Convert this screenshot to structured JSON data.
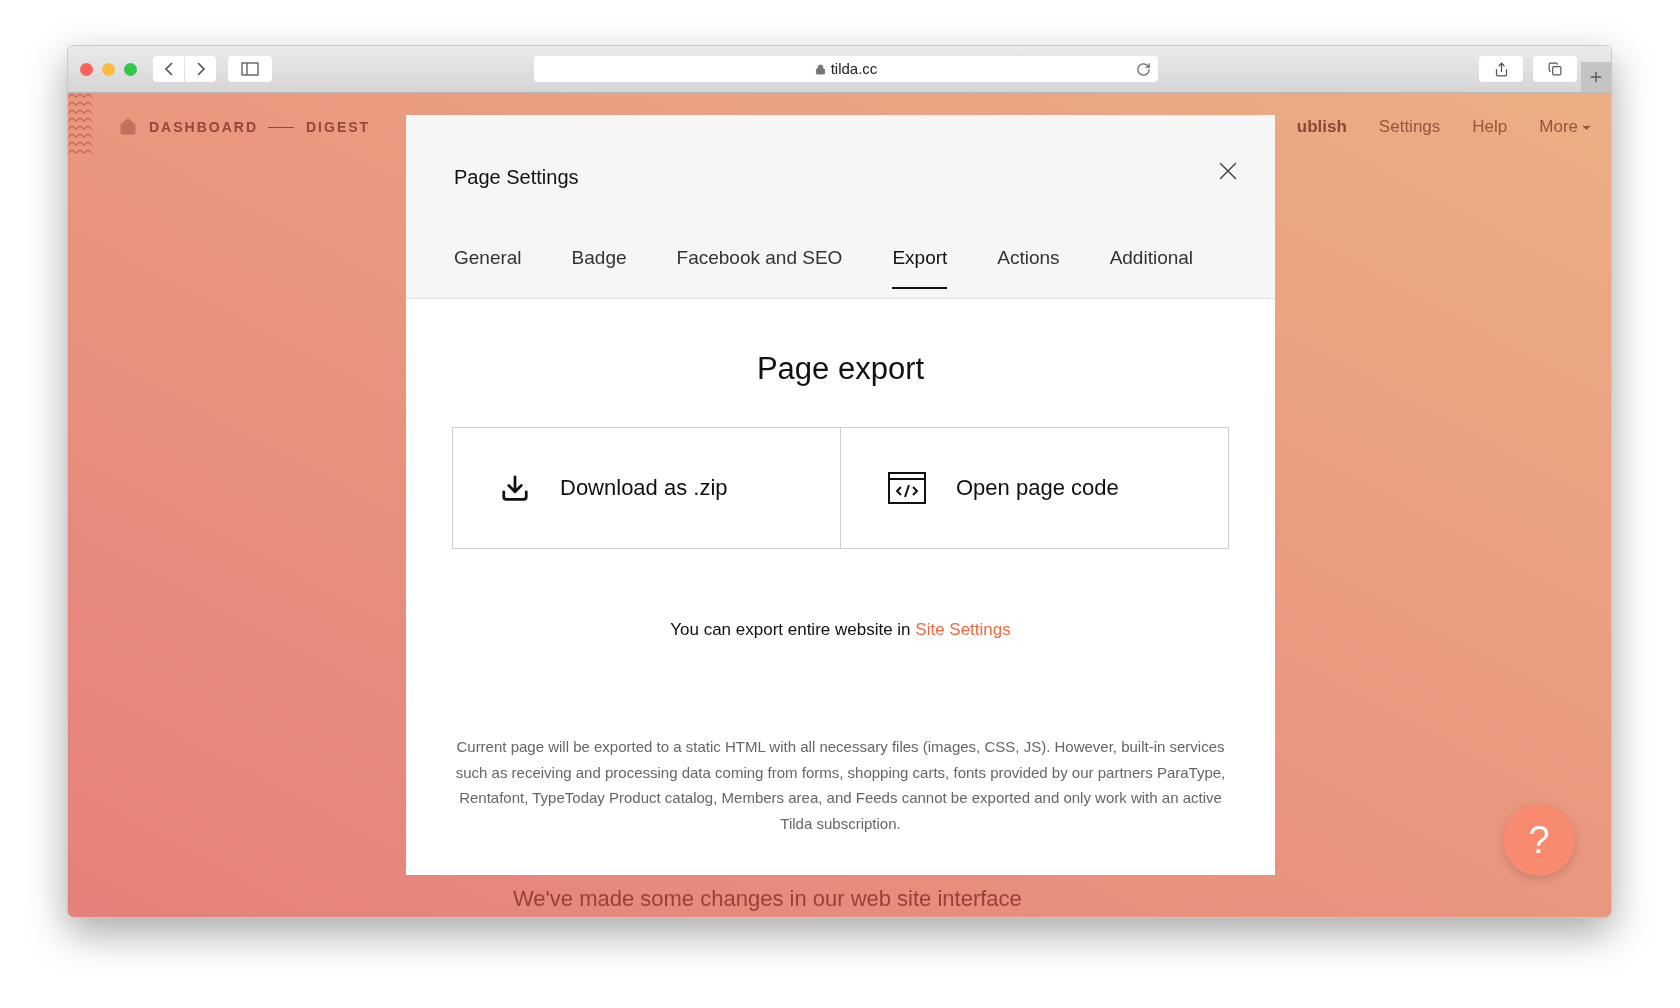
{
  "browser": {
    "address": "tilda.cc"
  },
  "header": {
    "breadcrumbs": [
      "DASHBOARD",
      "DIGEST"
    ],
    "nav": [
      "ublish",
      "Settings",
      "Help",
      "More"
    ]
  },
  "background_text": "We've made some changes in our web site interface",
  "modal": {
    "title": "Page Settings",
    "tabs": [
      {
        "label": "General",
        "selected": false
      },
      {
        "label": "Badge",
        "selected": false
      },
      {
        "label": "Facebook and SEO",
        "selected": false
      },
      {
        "label": "Export",
        "selected": true
      },
      {
        "label": "Actions",
        "selected": false
      },
      {
        "label": "Additional",
        "selected": false
      }
    ],
    "heading": "Page export",
    "options": [
      {
        "kind": "download",
        "label": "Download as .zip"
      },
      {
        "kind": "code",
        "label": "Open page code"
      }
    ],
    "site_note": {
      "text": "You can export entire website in",
      "link": "Site Settings"
    },
    "description": "Current page will be exported to a static HTML with all necessary files (images, CSS, JS). However, built-in services such as receiving and processing data coming from forms, shopping carts, fonts provided by our partners ParaType, Rentafont, TypeToday Product catalog, Members area, and Feeds cannot be exported and only work with an active Tilda subscription."
  },
  "help_button": "?"
}
